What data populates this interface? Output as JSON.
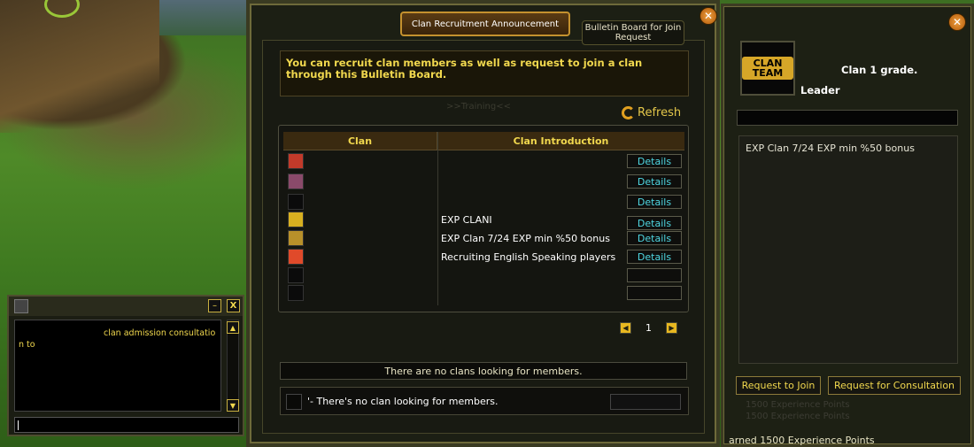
{
  "tabs": {
    "active": "Clan Recruitment Announcement",
    "inactive": "Bulletin Board for Join Request"
  },
  "notice": "You can recruit clan members as well as request to join a clan through this Bulletin Board.",
  "ghost_text": ">>Training<<",
  "refresh_label": "Refresh",
  "table": {
    "headers": {
      "clan": "Clan",
      "intro": "Clan Introduction"
    },
    "rows": [
      {
        "intro": "",
        "details": "Details"
      },
      {
        "intro": "",
        "details": "Details"
      },
      {
        "intro": "",
        "details": "Details"
      },
      {
        "intro": "EXP CLANI",
        "details": "Details"
      },
      {
        "intro": "EXP Clan 7/24 EXP min %50 bonus",
        "details": "Details"
      },
      {
        "intro": "Recruiting English Speaking players",
        "details": "Details"
      },
      {
        "intro": "",
        "details": ""
      },
      {
        "intro": "",
        "details": ""
      }
    ]
  },
  "pager": {
    "page": "1"
  },
  "status_bar": "There are no clans looking for members.",
  "message": "'- There's no clan looking for members.",
  "side": {
    "logo_text": "CLAN TEAM",
    "grade": "Clan 1 grade.",
    "role": "Leader",
    "intro": "EXP Clan 7/24 EXP min %50 bonus",
    "btn_join": "Request to Join",
    "btn_consult": "Request for Consultation",
    "exp_line": "arned 1500 Experience Points",
    "faint1": "1500 Experience Points",
    "faint2": "1500 Experience Points"
  },
  "chat": {
    "line1": "clan admission consultatio",
    "line2": "n to",
    "min": "–",
    "close": "X"
  },
  "close_glyph": "✕"
}
